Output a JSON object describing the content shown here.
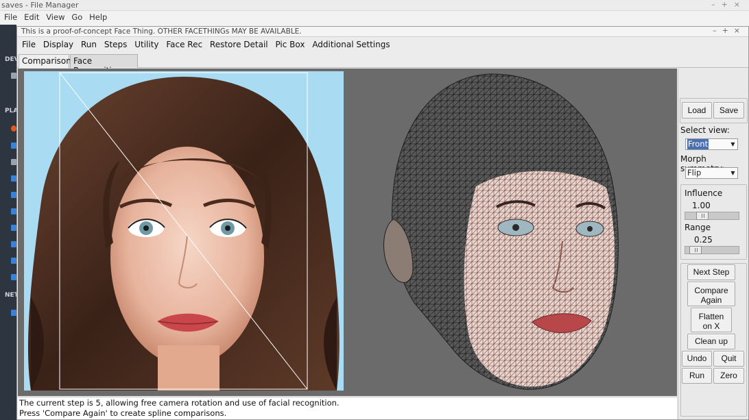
{
  "file_manager": {
    "title": "saves - File Manager",
    "menu": [
      "File",
      "Edit",
      "View",
      "Go",
      "Help"
    ],
    "sidebar_sections": [
      "DEV",
      "PLA",
      "NET"
    ]
  },
  "app": {
    "title": "This is a proof-of-concept Face Thing.  OTHER FACETHINGs MAY BE AVAILABLE.",
    "window_controls": [
      "–",
      "+",
      "×"
    ],
    "menu": [
      "File",
      "Display",
      "Run",
      "Steps",
      "Utility",
      "Face Rec",
      "Restore Detail",
      "Pic Box",
      "Additional Settings"
    ],
    "tabs": [
      "Comparisons",
      "Face Recognition"
    ],
    "active_tab": "Face Recognition"
  },
  "status": {
    "line1": "The current step is 5, allowing free camera rotation and use of facial recognition.",
    "line2": "Press 'Compare Again' to create spline comparisons."
  },
  "panel": {
    "load_label": "Load",
    "save_label": "Save",
    "select_view_label": "Select view:",
    "select_view_value": "Front",
    "morph_symmetry_label": "Morph symmetry:",
    "morph_symmetry_value": "Flip",
    "influence_label": "Influence",
    "influence_value": "1.00",
    "influence_level": 0.25,
    "range_label": "Range",
    "range_value": "0.25",
    "range_level": 0.1,
    "next_step_label": "Next Step",
    "compare_again_line1": "Compare",
    "compare_again_line2": "Again",
    "flatten_line1": "Flatten",
    "flatten_line2": "on X",
    "cleanup_label": "Clean up",
    "undo_label": "Undo",
    "quit_label": "Quit",
    "run_label": "Run",
    "zero_label": "Zero"
  },
  "colors": {
    "viewport_bg": "#6b6b6b",
    "photo_sky": "#a9dcf2",
    "mesh_line": "#202020",
    "mesh_skin": "#d9b8ad",
    "highlight": "#4b6fb3"
  }
}
